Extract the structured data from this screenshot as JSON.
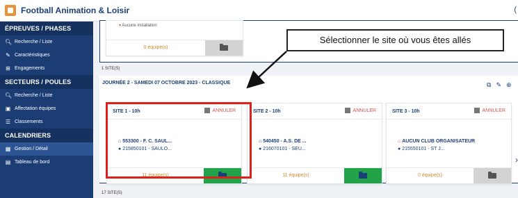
{
  "app": {
    "title": "Football Animation & Loisir",
    "header_right": "("
  },
  "sidebar": {
    "sections": [
      {
        "label": "ÉPREUVES / PHASES",
        "items": [
          {
            "icon": "search-icon",
            "label": "Recherche / Liste"
          },
          {
            "icon": "pencil-icon",
            "label": "Caractéristiques"
          },
          {
            "icon": "plus-box-icon",
            "label": "Engagements"
          }
        ]
      },
      {
        "label": "SECTEURS / POULES",
        "items": [
          {
            "icon": "search-icon",
            "label": "Recherche / Liste"
          },
          {
            "icon": "team-icon",
            "label": "Affectation équipes"
          },
          {
            "icon": "list-icon",
            "label": "Classements"
          }
        ]
      },
      {
        "label": "CALENDRIERS",
        "items": [
          {
            "icon": "calendar-icon",
            "label": "Gestion / Détail",
            "active": true
          },
          {
            "icon": "document-icon",
            "label": "Tableau de bord"
          }
        ]
      }
    ]
  },
  "top_partial": {
    "no_install": "Aucune installation",
    "teams": "0 équipe(s)"
  },
  "block1": {
    "sites_count": "1 SITE(S)",
    "journee": "JOURNÉE 2 - SAMEDI 07 OCTOBRE 2023 - CLASSIQUE"
  },
  "cards": [
    {
      "site": "SITE 1 - 10h",
      "annuler": "ANNULER",
      "line1": "553300 - F. C. SAUL...",
      "line2": "215850101 - SAULO...",
      "teams": "11 équipe(s)",
      "folder": "green",
      "line1_color": "#1c3f7a"
    },
    {
      "site": "SITE 2 - 10h",
      "annuler": "ANNULER",
      "line1": "540450 - A.S. DE ...",
      "line2": "216070101 - SEU...",
      "teams": "11 équipe(s)",
      "folder": "green",
      "line1_color": "#1c3f7a"
    },
    {
      "site": "SITE 3 - 10h",
      "annuler": "ANNULER",
      "line1": "AUCUN CLUB ORGANISATEUR",
      "line2": "215550101 - ST J...",
      "teams": "0 équipe(s)",
      "folder": "grey",
      "line1_color": "#1c3f7a"
    }
  ],
  "block2": {
    "sites_count": "17 SITE(S)"
  },
  "callout": {
    "text": "Sélectionner le site où vous êtes allés"
  },
  "colors": {
    "brand": "#1c3f7a",
    "sidebar": "#1b3d74",
    "highlight": "#e0201b",
    "success": "#22a34a",
    "warning_text": "#d08a2c"
  }
}
